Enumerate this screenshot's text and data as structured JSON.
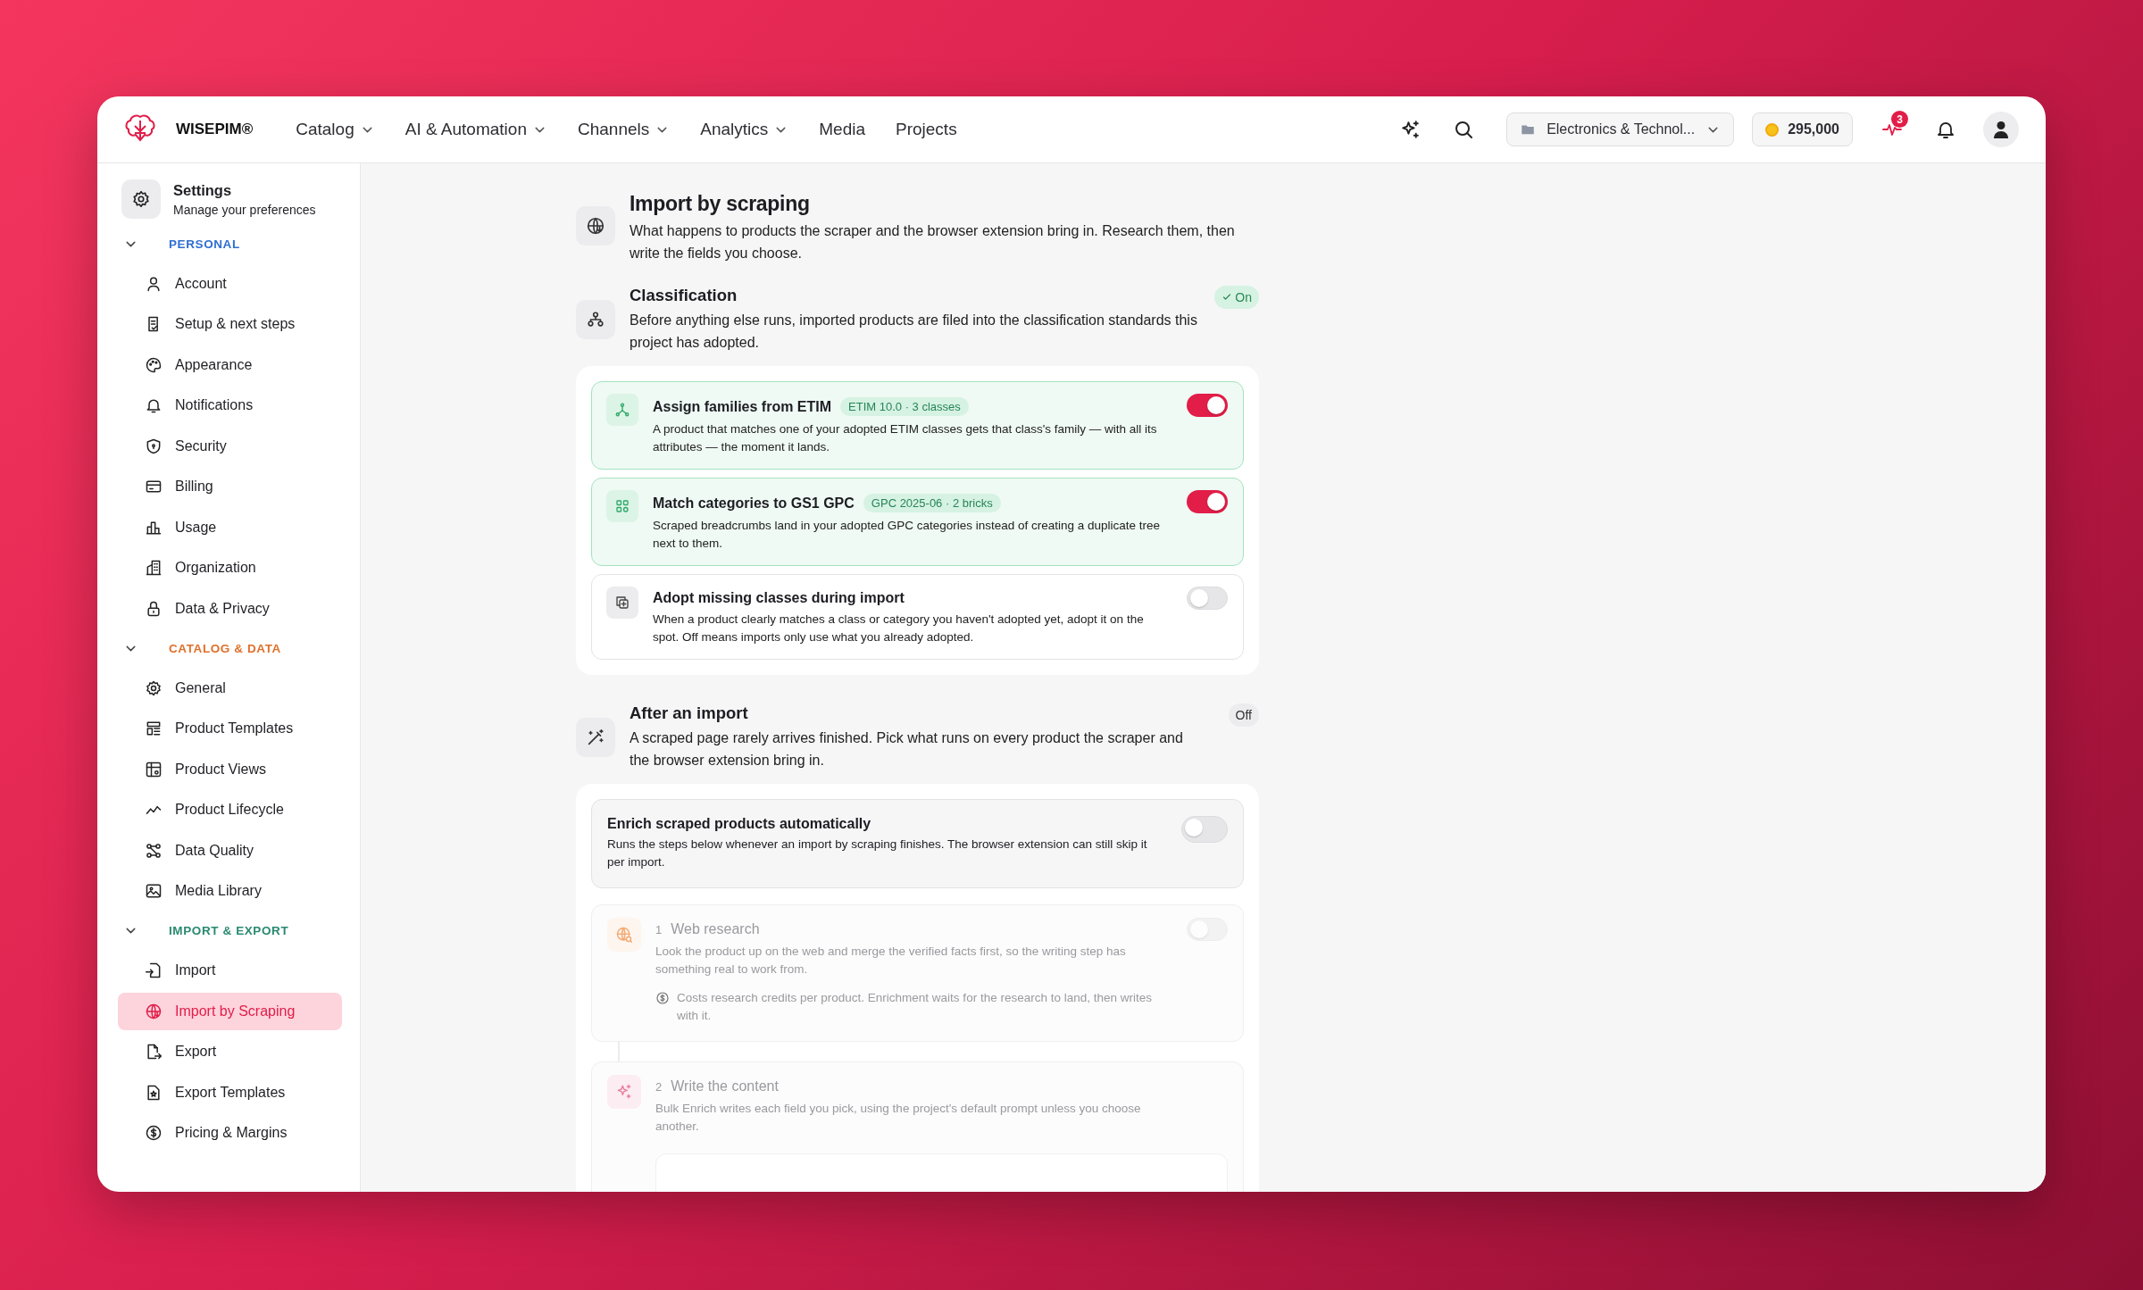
{
  "header": {
    "brand": "WISEPIM®",
    "nav": [
      {
        "label": "Catalog",
        "dropdown": true
      },
      {
        "label": "AI & Automation",
        "dropdown": true
      },
      {
        "label": "Channels",
        "dropdown": true
      },
      {
        "label": "Analytics",
        "dropdown": true
      },
      {
        "label": "Media",
        "dropdown": false
      },
      {
        "label": "Projects",
        "dropdown": false
      }
    ],
    "project": "Electronics & Technol...",
    "credits": "295,000",
    "activity_count": "3"
  },
  "sidebar": {
    "title": "Settings",
    "subtitle": "Manage your preferences",
    "groups": [
      {
        "label": "PERSONAL",
        "color": "#2f6fd1",
        "expanded": true,
        "items": [
          {
            "label": "Account",
            "selected": false
          },
          {
            "label": "Setup & next steps",
            "selected": false
          },
          {
            "label": "Appearance",
            "selected": false
          },
          {
            "label": "Notifications",
            "selected": false
          },
          {
            "label": "Security",
            "selected": false
          },
          {
            "label": "Billing",
            "selected": false
          },
          {
            "label": "Usage",
            "selected": false
          },
          {
            "label": "Organization",
            "selected": false
          },
          {
            "label": "Data & Privacy",
            "selected": false
          }
        ]
      },
      {
        "label": "CATALOG & DATA",
        "color": "#e0702a",
        "expanded": true,
        "items": [
          {
            "label": "General",
            "selected": false
          },
          {
            "label": "Product Templates",
            "selected": false
          },
          {
            "label": "Product Views",
            "selected": false
          },
          {
            "label": "Product Lifecycle",
            "selected": false
          },
          {
            "label": "Data Quality",
            "selected": false
          },
          {
            "label": "Media Library",
            "selected": false
          }
        ]
      },
      {
        "label": "IMPORT & EXPORT",
        "color": "#2a8a70",
        "expanded": true,
        "items": [
          {
            "label": "Import",
            "selected": false
          },
          {
            "label": "Import by Scraping",
            "selected": true
          },
          {
            "label": "Export",
            "selected": false
          },
          {
            "label": "Export Templates",
            "selected": false
          },
          {
            "label": "Pricing & Margins",
            "selected": false
          }
        ]
      }
    ]
  },
  "page": {
    "title": "Import by scraping",
    "description": "What happens to products the scraper and the browser extension bring in. Research them, then write the fields you choose."
  },
  "sections": [
    {
      "kind": "classification",
      "title": "Classification",
      "description": "Before anything else runs, imported products are filed into the classification standards this project has adopted.",
      "status": "On",
      "status_on": true,
      "options": [
        {
          "title": "Assign families from ETIM",
          "tag": "ETIM 10.0 · 3 classes",
          "description": "A product that matches one of your adopted ETIM classes gets that class's family — with all its attributes — the moment it lands.",
          "on": true
        },
        {
          "title": "Match categories to GS1 GPC",
          "tag": "GPC 2025-06 · 2 bricks",
          "description": "Scraped breadcrumbs land in your adopted GPC categories instead of creating a duplicate tree next to them.",
          "on": true
        },
        {
          "title": "Adopt missing classes during import",
          "description": "When a product clearly matches a class or category you haven't adopted yet, adopt it on the spot. Off means imports only use what you already adopted.",
          "on": false
        }
      ]
    },
    {
      "kind": "after_import",
      "title": "After an import",
      "description": "A scraped page rarely arrives finished. Pick what runs on every product the scraper and the browser extension bring in.",
      "status": "Off",
      "status_on": false,
      "master": {
        "title": "Enrich scraped products automatically",
        "description": "Runs the steps below whenever an import by scraping finishes. The browser extension can still skip it per import.",
        "on": false
      },
      "steps": [
        {
          "number": "1",
          "title": "Web research",
          "description": "Look the product up on the web and merge the verified facts first, so the writing step has something real to work from.",
          "note": "Costs research credits per product. Enrichment waits for the research to land, then writes with it.",
          "on": false,
          "disabled": true
        },
        {
          "number": "2",
          "title": "Write the content",
          "description": "Bulk Enrich writes each field you pick, using the project's default prompt unless you choose another.",
          "disabled": true
        }
      ]
    }
  ]
}
